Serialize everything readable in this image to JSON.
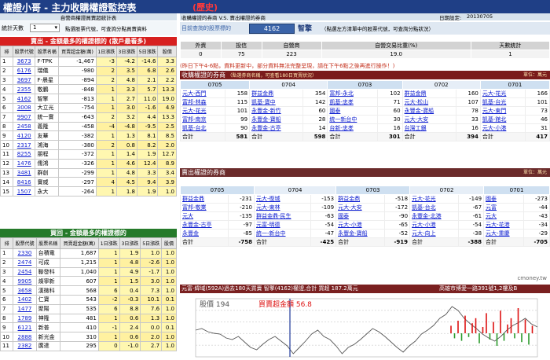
{
  "header": {
    "title": "權證小哥 - 主力收購權證監控表",
    "date_badge": "(歷史)"
  },
  "subheader": {
    "left": "自營商權證買賣超統計表",
    "right_left": "收購權證的券商 V.S. 賣出權證的券商",
    "date_label": "日期設定:",
    "date_value": "20130705"
  },
  "controls": {
    "days_label": "統計天數",
    "days_value": "1",
    "hint": "點選股票代號，可查詢分點買賣資料"
  },
  "sell_table": {
    "title": "賣出 - 金額最多的權證標的 (散戶最看多)",
    "headers": [
      "排",
      "股票代號",
      "股票名稱",
      "買賣超金額(萬)",
      "1日漲跌",
      "3日漲跌",
      "5日漲跌",
      "股價"
    ],
    "rows": [
      [
        "1",
        "3673",
        "F-TPK",
        "-1,467",
        "-3",
        "-4.2",
        "-14.6",
        "3.3"
      ],
      [
        "2",
        "6176",
        "瑞儀",
        "-980",
        "2",
        "3.5",
        "6.8",
        "2.6"
      ],
      [
        "3",
        "3697",
        "F-晨星",
        "-894",
        "2",
        "4.8",
        "2.1",
        "2.2"
      ],
      [
        "4",
        "2355",
        "敬鵬",
        "-848",
        "1",
        "3.3",
        "5.7",
        "13.3"
      ],
      [
        "5",
        "4162",
        "智擎",
        "-813",
        "1",
        "2.7",
        "11.0",
        "19.0"
      ],
      [
        "6",
        "3008",
        "大立光",
        "-754",
        "1",
        "3.0",
        "-1.6",
        "4.9"
      ],
      [
        "7",
        "9907",
        "統一實",
        "-643",
        "2",
        "3.2",
        "4.4",
        "13.3"
      ],
      [
        "8",
        "2458",
        "義隆",
        "-458",
        "-4",
        "-4.8",
        "-9.5",
        "2.5"
      ],
      [
        "9",
        "4120",
        "友華",
        "-382",
        "1",
        "1.3",
        "8.1",
        "8.5"
      ],
      [
        "10",
        "2317",
        "鴻海",
        "-380",
        "2",
        "0.8",
        "8.2",
        "2.0"
      ],
      [
        "11",
        "8255",
        "朋程",
        "-372",
        "1",
        "1.4",
        "1.9",
        "12.7"
      ],
      [
        "12",
        "1476",
        "儒鴻",
        "-326",
        "1",
        "4.6",
        "12.4",
        "8.9"
      ],
      [
        "13",
        "3481",
        "群創",
        "-299",
        "1",
        "4.8",
        "3.3",
        "3.4"
      ],
      [
        "14",
        "8416",
        "實威",
        "-297",
        "4",
        "4.5",
        "9.4",
        "3.9"
      ],
      [
        "15",
        "1507",
        "永大",
        "-264",
        "1",
        "1.8",
        "1.9",
        "1.0"
      ]
    ]
  },
  "buy_table": {
    "title": "買回 - 金額最多的權證標的",
    "headers": [
      "排",
      "股票代號",
      "股票名稱",
      "買賣超金額(萬)",
      "1日漲跌",
      "3日漲跌",
      "5日漲跌",
      "股價"
    ],
    "rows": [
      [
        "1",
        "2330",
        "台積電",
        "1,687",
        "1",
        "1.9",
        "1.0",
        "1.0"
      ],
      [
        "2",
        "2474",
        "可成",
        "1,215",
        "1",
        "4.8",
        "-2.6",
        "1.0"
      ],
      [
        "3",
        "2454",
        "聯發科",
        "1,040",
        "1",
        "4.9",
        "-1.7",
        "1.0"
      ],
      [
        "4",
        "9905",
        "燦寧新",
        "607",
        "1",
        "1.5",
        "3.0",
        "1.0"
      ],
      [
        "5",
        "3658",
        "漢微科",
        "568",
        "6",
        "0.4",
        "7.3",
        "1.0"
      ],
      [
        "6",
        "1402",
        "仁寶",
        "543",
        "-2",
        "-0.3",
        "10.1",
        "0.1"
      ],
      [
        "7",
        "1477",
        "聚陽",
        "535",
        "6",
        "8.8",
        "7.6",
        "1.0"
      ],
      [
        "8",
        "1789",
        "神隆",
        "481",
        "1",
        "0.6",
        "1.3",
        "1.0"
      ],
      [
        "9",
        "6121",
        "新普",
        "410",
        "-1",
        "2.4",
        "0.0",
        "0.1"
      ],
      [
        "10",
        "2888",
        "新光金",
        "310",
        "1",
        "0.6",
        "2.0",
        "1.0"
      ],
      [
        "11",
        "2382",
        "廣達",
        "295",
        "0",
        "-1.0",
        "2.7",
        "1.0"
      ]
    ]
  },
  "stock": {
    "label": "目前查詢的股票標的",
    "code": "4162",
    "name": "智擎",
    "hint": "（點選左方清單中的股票代號，可查詢分點狀況）"
  },
  "stats": {
    "headers": [
      "外資",
      "投信",
      "自營商",
      "自營交易比重(%)",
      "天數統計"
    ],
    "values": [
      "0",
      "75",
      "223",
      "19.0",
      "1"
    ]
  },
  "note": "(昨日下午4-6點，資料更新中，部分資料無法完整呈現，請在下午6點之後再進行操作！)",
  "buy_section": {
    "title": "收購權證的券商",
    "sub": "（點選券商名稱，可查看180日買賣狀況）",
    "unit": "單位：萬元",
    "dates": [
      "0705",
      "0704",
      "0703",
      "0702",
      "0701"
    ],
    "cols": [
      [
        [
          "元大-西門",
          "158"
        ],
        [
          "富邦-林森",
          "115"
        ],
        [
          "元大-花光",
          "101"
        ],
        [
          "富邦-南京",
          "99"
        ],
        [
          "凱基-台北",
          "90"
        ]
      ],
      [
        [
          "群益金鼎",
          "354"
        ],
        [
          "凱基-寶中",
          "142"
        ],
        [
          "永豐金-新竹",
          "60"
        ],
        [
          "永豐金-寶船",
          "28"
        ],
        [
          "永豐金-古亭",
          "14"
        ]
      ],
      [
        [
          "富邦-永北",
          "102"
        ],
        [
          "凱基-忠孝",
          "71"
        ],
        [
          "國泰",
          "60"
        ],
        [
          "統一新台中",
          "30"
        ],
        [
          "台新-忠孝",
          "16"
        ]
      ],
      [
        [
          "群益金鼎",
          "160"
        ],
        [
          "元大-松山",
          "107"
        ],
        [
          "永豐金-寶船",
          "78"
        ],
        [
          "元大-大安",
          "33"
        ],
        [
          "台灣工銀",
          "16"
        ]
      ],
      [
        [
          "元大-花光",
          "166"
        ],
        [
          "凱基-台光",
          "101"
        ],
        [
          "元大-東門",
          "73"
        ],
        [
          "凱基-館北",
          "46"
        ],
        [
          "元大-小港",
          "31"
        ]
      ]
    ],
    "sum_label": "合計",
    "sums": [
      "581",
      "598",
      "301",
      "394",
      "417"
    ]
  },
  "sell_section": {
    "title": "賣出權證的券商",
    "unit": "單位：萬元",
    "cols": [
      [
        [
          "群益金鼎",
          "-231"
        ],
        [
          "富邦-敬業",
          "-210"
        ],
        [
          "元大",
          "-135"
        ],
        [
          "永豐金-古亭",
          "-97"
        ],
        [
          "永豐金",
          "-85"
        ]
      ],
      [
        [
          "元大-復城",
          "-153"
        ],
        [
          "元大-東林",
          "-109"
        ],
        [
          "群益金鼎-民生",
          "-63"
        ],
        [
          "元富-明德",
          "-54"
        ],
        [
          "統一-新台中",
          "-47"
        ]
      ],
      [
        [
          "群益金鼎",
          "-518"
        ],
        [
          "元大-大安",
          "-172"
        ],
        [
          "國泰",
          "-90"
        ],
        [
          "元大-小港",
          "-65"
        ],
        [
          "永豐金-寶船",
          "-52"
        ]
      ],
      [
        [
          "元大-花光",
          "-149"
        ],
        [
          "凱基-台北",
          "-67"
        ],
        [
          "永豐金-北港",
          "-61"
        ],
        [
          "元大-小港",
          "-54"
        ],
        [
          "元大-向上",
          "-38"
        ]
      ],
      [
        [
          "國泰",
          "-273"
        ],
        [
          "元富",
          "-44"
        ],
        [
          "元大",
          "-43"
        ],
        [
          "元大-花港",
          "-34"
        ],
        [
          "元大-重慶",
          "-29"
        ]
      ]
    ],
    "sum_label": "合計",
    "sums": [
      "-758",
      "-425",
      "-919",
      "-388",
      "-705"
    ]
  },
  "chart_bar": {
    "title": "元富-緯域(592A)過去180天買賣 智擎(4162)權證,合計 買超 187.2萬元",
    "ticker": "高雄市博愛一路391號1,2樓及B",
    "watermark": "cmoney.tw"
  },
  "chart_data": {
    "type": "line",
    "title": "",
    "legend": [
      "股價 194",
      "買賣超金額 56.8"
    ],
    "price": [
      190,
      192,
      188,
      186,
      185,
      180,
      178,
      182,
      175,
      168,
      165,
      172,
      178,
      182,
      176,
      170,
      160,
      168,
      176,
      185,
      190,
      182,
      178,
      170,
      160,
      168,
      172,
      178,
      185,
      192,
      188,
      182,
      175,
      168,
      162,
      170,
      176,
      185,
      190,
      196,
      205,
      210,
      220,
      215,
      205,
      198,
      192,
      185,
      180,
      176,
      182,
      190,
      196,
      200,
      205,
      198,
      194
    ],
    "colors": {
      "price": "#555555",
      "buy": "#d11",
      "sell": "#2a9a2a",
      "marker": "#1f3a9a"
    }
  }
}
